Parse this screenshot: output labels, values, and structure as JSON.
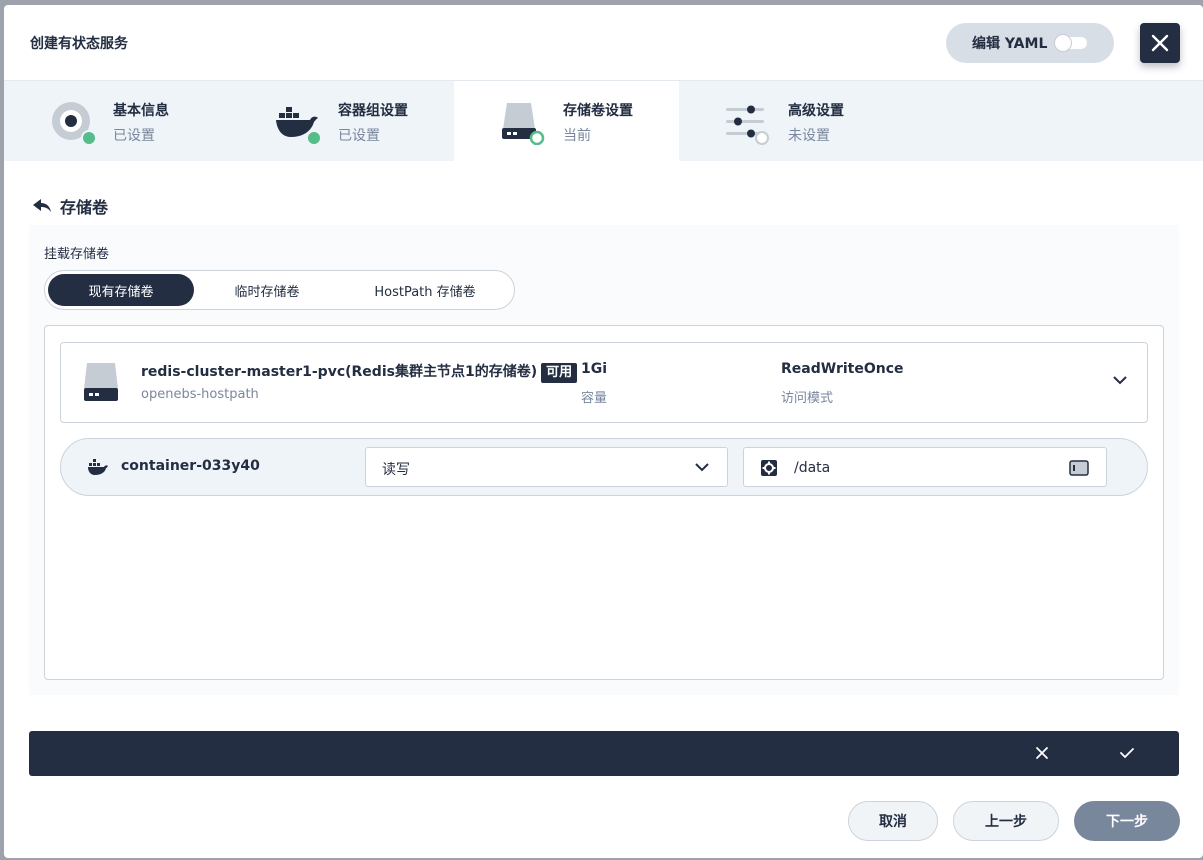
{
  "modal": {
    "title": "创建有状态服务",
    "yaml_button": "编辑 YAML"
  },
  "steps": [
    {
      "title": "基本信息",
      "status": "已设置",
      "icon": "disk-icon"
    },
    {
      "title": "容器组设置",
      "status": "已设置",
      "icon": "docker-icon"
    },
    {
      "title": "存储卷设置",
      "status": "当前",
      "icon": "storage-icon"
    },
    {
      "title": "高级设置",
      "status": "未设置",
      "icon": "sliders-icon"
    }
  ],
  "section": {
    "title": "存储卷",
    "mount_label": "挂载存储卷",
    "tabs": [
      "现有存储卷",
      "临时存储卷",
      "HostPath 存储卷"
    ],
    "selected_tab": "现有存储卷"
  },
  "volume": {
    "name": "redis-cluster-master1-pvc(Redis集群主节点1的存储卷)",
    "badge": "可用",
    "storage_class": "openebs-hostpath",
    "capacity": "1Gi",
    "capacity_label": "容量",
    "access_mode": "ReadWriteOnce",
    "access_mode_label": "访问模式"
  },
  "container": {
    "name": "container-033y40",
    "mode": "读写",
    "mount_path": "/data"
  },
  "footer": {
    "cancel": "取消",
    "prev": "上一步",
    "next": "下一步"
  },
  "colors": {
    "primary": "#242e42",
    "success": "#55bc8a",
    "muted": "#79879c",
    "panel_bg": "#eff4f9"
  }
}
